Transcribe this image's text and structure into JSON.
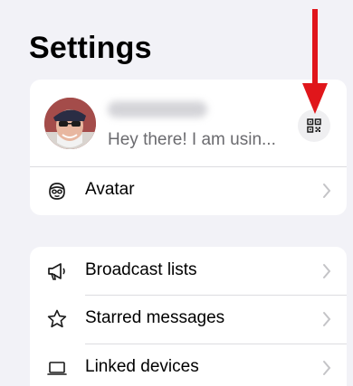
{
  "header": {
    "title": "Settings"
  },
  "profile": {
    "status": "Hey there! I am usin..."
  },
  "rows_top": [
    {
      "label": "Avatar",
      "icon": "avatar-face-icon"
    }
  ],
  "rows_list": [
    {
      "label": "Broadcast lists",
      "icon": "megaphone-icon"
    },
    {
      "label": "Starred messages",
      "icon": "star-icon"
    },
    {
      "label": "Linked devices",
      "icon": "laptop-icon"
    }
  ],
  "colors": {
    "background": "#f2f2f7",
    "card": "#ffffff",
    "secondary_text": "#6b6b6f",
    "chevron": "#c4c4c7",
    "annotation_arrow": "#e0161b"
  }
}
